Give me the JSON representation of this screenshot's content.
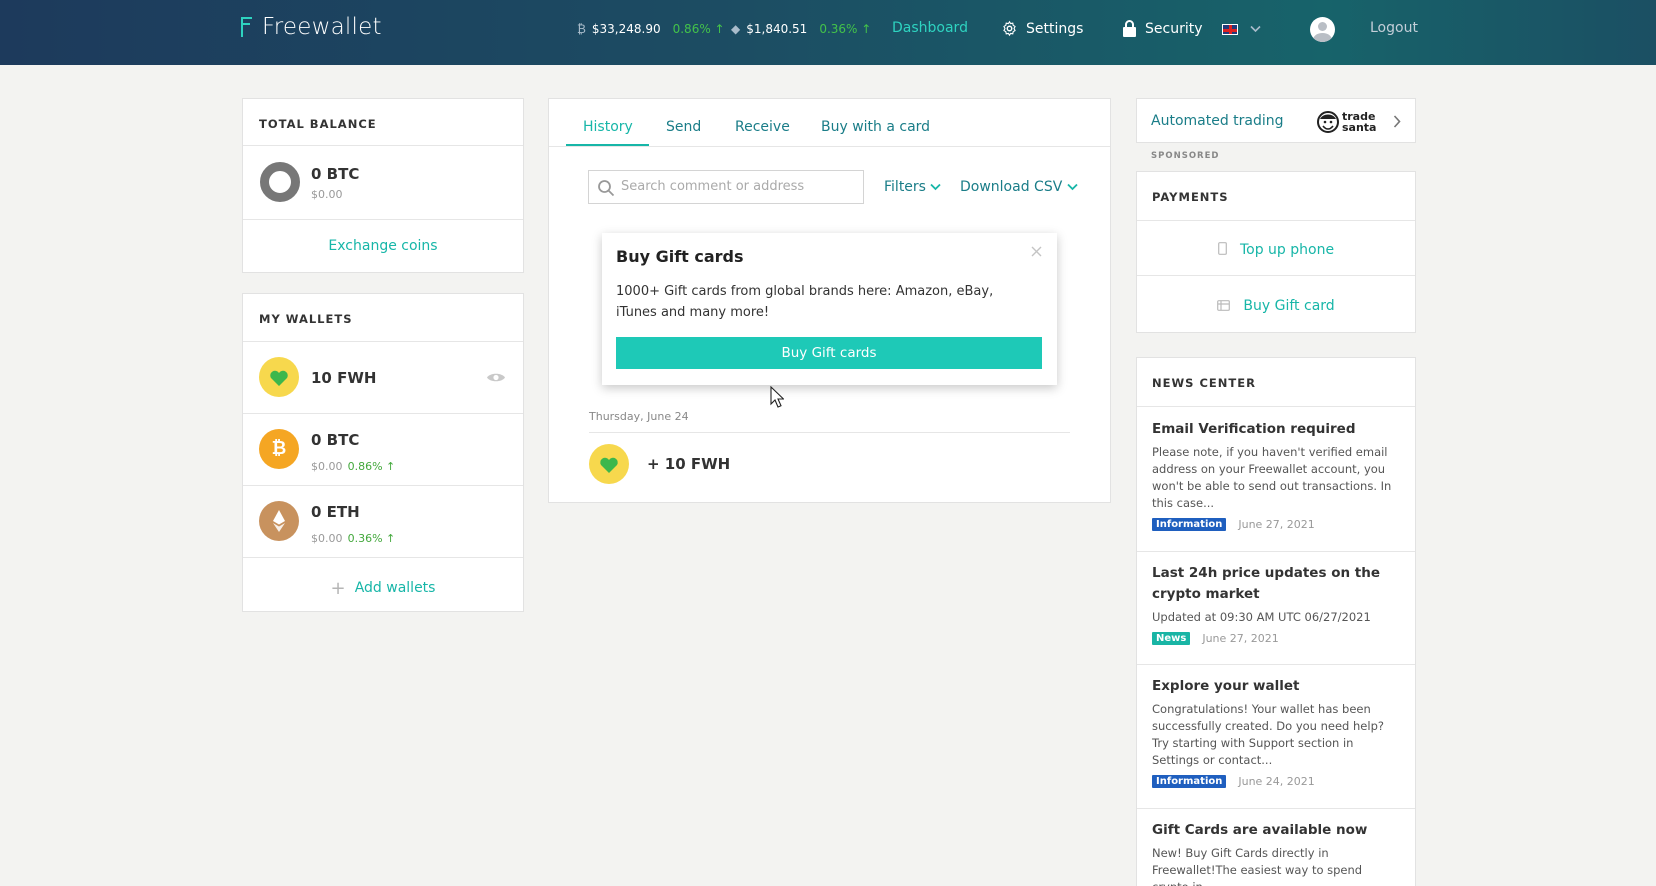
{
  "header": {
    "brand": "Freewallet",
    "btc_price": "$33,248.90",
    "btc_change": "0.86% ↑",
    "eth_price": "$1,840.51",
    "eth_change": "0.36% ↑",
    "nav": {
      "dashboard": "Dashboard",
      "settings": "Settings",
      "security": "Security",
      "logout": "Logout"
    }
  },
  "balance": {
    "title": "TOTAL BALANCE",
    "amount": "0 BTC",
    "usd": "$0.00",
    "exchange": "Exchange coins"
  },
  "wallets": {
    "title": "MY WALLETS",
    "items": [
      {
        "amount": "10 FWH",
        "usd": "",
        "change": ""
      },
      {
        "amount": "0 BTC",
        "usd": "$0.00",
        "change": "0.86% ↑"
      },
      {
        "amount": "0 ETH",
        "usd": "$0.00",
        "change": "0.36% ↑"
      }
    ],
    "add": "Add wallets"
  },
  "tabs": [
    "History",
    "Send",
    "Receive",
    "Buy with a card"
  ],
  "search": {
    "placeholder": "Search comment or address"
  },
  "filters": "Filters",
  "download": "Download CSV",
  "popup": {
    "title": "Buy Gift cards",
    "body": "1000+ Gift cards from global brands here: Amazon, eBay, iTunes and many more!",
    "button": "Buy Gift cards"
  },
  "history": {
    "date": "Thursday, June 24",
    "entry": "+ 10 FWH"
  },
  "promo": {
    "label": "Automated trading",
    "logo_line1": "trade",
    "logo_line2": "santa",
    "sponsored": "SPONSORED"
  },
  "payments": {
    "title": "PAYMENTS",
    "top_up": "Top up phone",
    "gift": "Buy Gift card"
  },
  "news": {
    "title": "NEWS CENTER",
    "items": [
      {
        "title": "Email Verification required",
        "body": "Please note, if you haven't verified email address on your Freewallet account, you won't be able to send out transactions. In this case...",
        "badge": "Information",
        "date": "June 27, 2021"
      },
      {
        "title": "Last 24h price updates on the crypto market",
        "body": "Updated at 09:30 AM UTC 06/27/2021",
        "badge": "News",
        "date": "June 27, 2021"
      },
      {
        "title": "Explore your wallet",
        "body": "Congratulations! Your wallet has been successfully created. Do you need help? Try starting with Support section in Settings or contact...",
        "badge": "Information",
        "date": "June 24, 2021"
      },
      {
        "title": "Gift Cards are available now",
        "body": "New! Buy Gift Cards directly in Freewallet!The easiest way to spend crypto in",
        "badge": "",
        "date": ""
      }
    ]
  },
  "colors": {
    "accent": "#17b6a8",
    "badge_info": "#1f5fbf",
    "badge_news": "#19b5a5"
  }
}
